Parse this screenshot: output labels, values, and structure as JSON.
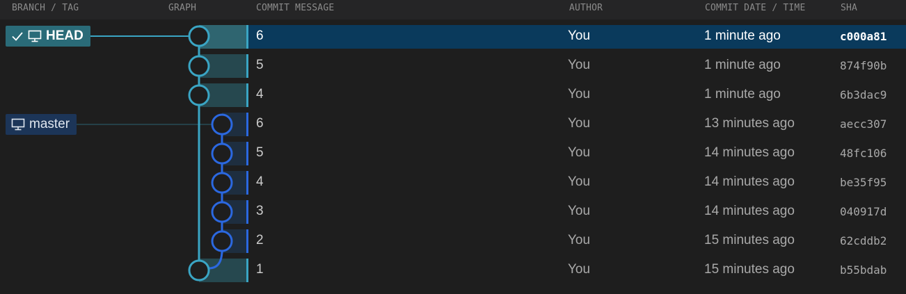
{
  "columns": {
    "branch": "BRANCH / TAG",
    "graph": "GRAPH",
    "message": "COMMIT MESSAGE",
    "author": "AUTHOR",
    "date": "COMMIT DATE / TIME",
    "sha": "SHA"
  },
  "badges": {
    "head": {
      "label": "HEAD",
      "check_icon": "check-icon",
      "type_icon": "monitor-icon"
    },
    "master": {
      "label": "master",
      "type_icon": "monitor-icon"
    }
  },
  "colors": {
    "lane0": "#3aa5c4",
    "lane1": "#2b68e0",
    "selected": "#0a3a5c"
  },
  "commits": [
    {
      "message": "6",
      "author": "You",
      "date": "1 minute ago",
      "sha": "c000a81"
    },
    {
      "message": "5",
      "author": "You",
      "date": "1 minute ago",
      "sha": "874f90b"
    },
    {
      "message": "4",
      "author": "You",
      "date": "1 minute ago",
      "sha": "6b3dac9"
    },
    {
      "message": "6",
      "author": "You",
      "date": "13 minutes ago",
      "sha": "aecc307"
    },
    {
      "message": "5",
      "author": "You",
      "date": "14 minutes ago",
      "sha": "48fc106"
    },
    {
      "message": "4",
      "author": "You",
      "date": "14 minutes ago",
      "sha": "be35f95"
    },
    {
      "message": "3",
      "author": "You",
      "date": "14 minutes ago",
      "sha": "040917d"
    },
    {
      "message": "2",
      "author": "You",
      "date": "15 minutes ago",
      "sha": "62cddb2"
    },
    {
      "message": "1",
      "author": "You",
      "date": "15 minutes ago",
      "sha": "b55bdab"
    }
  ]
}
